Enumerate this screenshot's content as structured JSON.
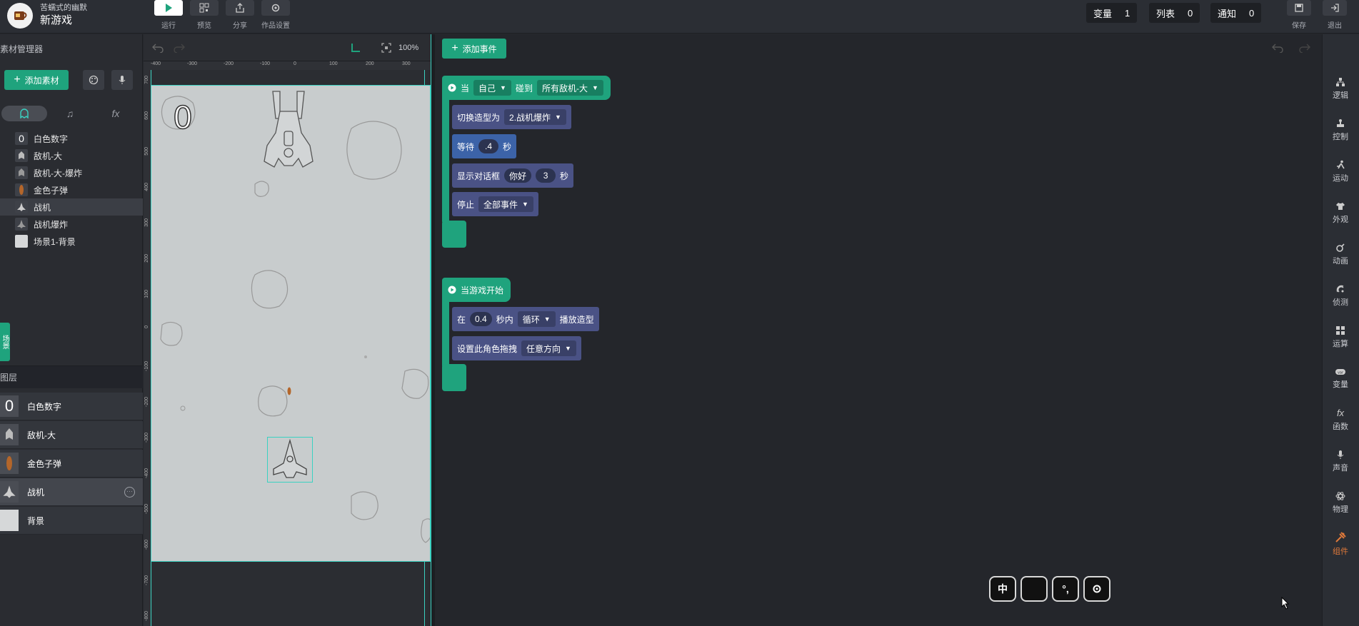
{
  "header": {
    "user_name": "苦蠕式的幽默",
    "project_title": "新游戏",
    "run_label": "运行",
    "preview_label": "预览",
    "share_label": "分享",
    "settings_label": "作品设置",
    "counters": [
      {
        "label": "变量",
        "value": "1"
      },
      {
        "label": "列表",
        "value": "0"
      },
      {
        "label": "通知",
        "value": "0"
      }
    ],
    "save_label": "保存",
    "exit_label": "退出"
  },
  "asset_manager": {
    "title": "素材管理器",
    "add_label": "添加素材",
    "tab_fx": "fx",
    "items": [
      {
        "label": "白色数字",
        "thumb": "0"
      },
      {
        "label": "敌机-大",
        "thumb": ""
      },
      {
        "label": "敌机-大-爆炸",
        "thumb": ""
      },
      {
        "label": "金色子弹",
        "thumb": ""
      },
      {
        "label": "战机",
        "thumb": ""
      },
      {
        "label": "战机爆炸",
        "thumb": ""
      },
      {
        "label": "场景1-背景",
        "thumb": ""
      }
    ],
    "scene_tab": "场景"
  },
  "layers": {
    "title": "图层",
    "items": [
      {
        "label": "白色数字",
        "thumb": "0"
      },
      {
        "label": "敌机-大",
        "thumb": ""
      },
      {
        "label": "金色子弹",
        "thumb": ""
      },
      {
        "label": "战机",
        "thumb": ""
      },
      {
        "label": "背景",
        "thumb": ""
      }
    ]
  },
  "stage": {
    "zoom": "100%",
    "score": "0",
    "ruler_top": [
      "-400",
      "-300",
      "-200",
      "-100",
      "0",
      "100",
      "200",
      "300"
    ],
    "ruler_left": [
      "700",
      "600",
      "500",
      "400",
      "300",
      "200",
      "100",
      "0",
      "-100",
      "-200",
      "-300",
      "-400",
      "-500",
      "-600",
      "-700",
      "-800"
    ]
  },
  "code": {
    "add_event_label": "添加事件",
    "event1": {
      "when": "当",
      "self": "自己",
      "hits": "碰到",
      "target": "所有敌机-大",
      "switch_costume": "切换造型为",
      "costume": "2.战机爆炸",
      "wait": "等待",
      "wait_value": ".4",
      "seconds": "秒",
      "show_dialog": "显示对话框",
      "dialog_text": "你好",
      "dialog_secs": "3",
      "dialog_sec_unit": "秒",
      "stop": "停止",
      "stop_target": "全部事件"
    },
    "event2": {
      "when_start": "当游戏开始",
      "in": "在",
      "anim_secs": "0.4",
      "secs_within": "秒内",
      "loop": "循环",
      "play_costume": "播放造型",
      "set_drag": "设置此角色拖拽",
      "direction": "任意方向"
    },
    "round_buttons": [
      "中",
      "",
      "",
      ""
    ]
  },
  "categories": [
    {
      "label": "逻辑",
      "icon": "logic-icon"
    },
    {
      "label": "控制",
      "icon": "control-icon"
    },
    {
      "label": "运动",
      "icon": "motion-icon"
    },
    {
      "label": "外观",
      "icon": "looks-icon"
    },
    {
      "label": "动画",
      "icon": "animation-icon"
    },
    {
      "label": "侦测",
      "icon": "sensing-icon"
    },
    {
      "label": "运算",
      "icon": "operators-icon"
    },
    {
      "label": "变量",
      "icon": "variables-icon"
    },
    {
      "label": "函数",
      "icon": "function-icon"
    },
    {
      "label": "声音",
      "icon": "sound-icon"
    },
    {
      "label": "物理",
      "icon": "physics-icon"
    },
    {
      "label": "组件",
      "icon": "components-icon"
    }
  ],
  "colors": {
    "accent": "#1fa37d",
    "event_block": "#4a5285",
    "active_category": "#e0793a",
    "stage_bg": "#c8cccd"
  }
}
